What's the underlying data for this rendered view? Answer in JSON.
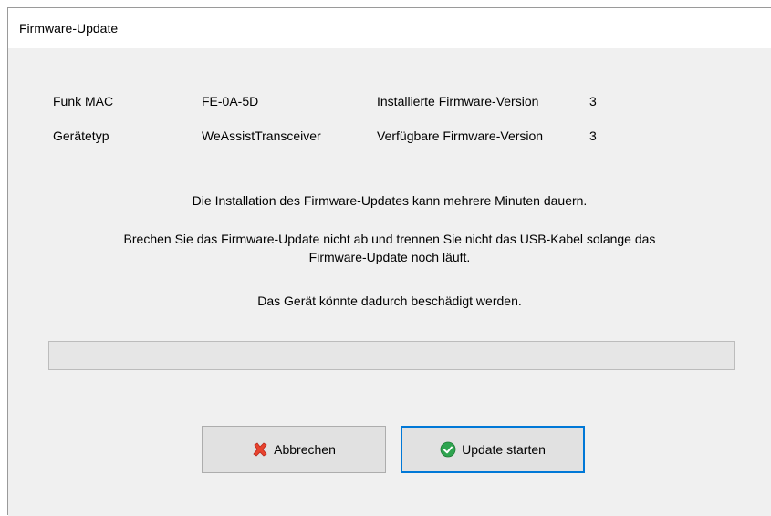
{
  "window": {
    "title": "Firmware-Update"
  },
  "info": {
    "mac_label": "Funk MAC",
    "mac_value": "FE-0A-5D",
    "installed_label": "Installierte Firmware-Version",
    "installed_value": "3",
    "device_type_label": "Gerätetyp",
    "device_type_value": "WeAssistTransceiver",
    "available_label": "Verfügbare Firmware-Version",
    "available_value": "3"
  },
  "messages": {
    "duration": "Die Installation des Firmware-Updates kann mehrere Minuten dauern.",
    "warning_line1": "Brechen Sie das Firmware-Update nicht ab und trennen Sie nicht das USB-Kabel solange das",
    "warning_line2": "Firmware-Update noch läuft.",
    "damage": "Das Gerät könnte dadurch beschädigt werden."
  },
  "progress": {
    "value": 0
  },
  "buttons": {
    "cancel_label": "Abbrechen",
    "cancel_icon": "red-x-icon",
    "start_label": "Update starten",
    "start_icon": "green-check-icon"
  },
  "colors": {
    "primary_border": "#0078d7",
    "cancel_icon": "#e8432e",
    "start_icon": "#2ea44f"
  }
}
